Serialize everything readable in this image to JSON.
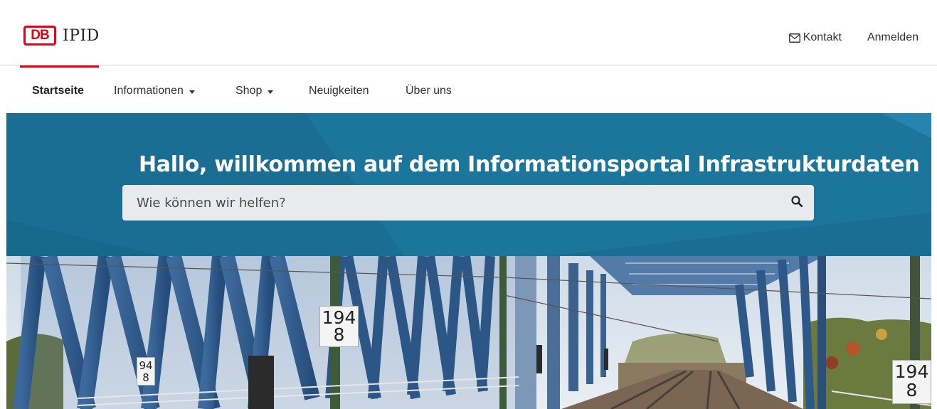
{
  "brand": {
    "badge": "DB",
    "name": "IPID",
    "accent": "#ec0016"
  },
  "header": {
    "contact_label": "Kontakt",
    "login_label": "Anmelden"
  },
  "nav": {
    "items": [
      {
        "label": "Startseite",
        "active": true,
        "dropdown": false
      },
      {
        "label": "Informationen",
        "active": false,
        "dropdown": true
      },
      {
        "label": "Shop",
        "active": false,
        "dropdown": true
      },
      {
        "label": "Neuigkeiten",
        "active": false,
        "dropdown": false
      },
      {
        "label": "Über uns",
        "active": false,
        "dropdown": false
      }
    ]
  },
  "hero": {
    "greeting": "Hallo,",
    "title_rest": " willkommen auf dem Informationsportal Infrastrukturdaten",
    "search_placeholder": "Wie können wir helfen?",
    "band_color": "#1a6e93"
  },
  "photo": {
    "signs": [
      {
        "top": "194",
        "bottom": "8"
      },
      {
        "top": "94",
        "bottom": "8"
      },
      {
        "top": "194",
        "bottom": "8"
      }
    ]
  }
}
